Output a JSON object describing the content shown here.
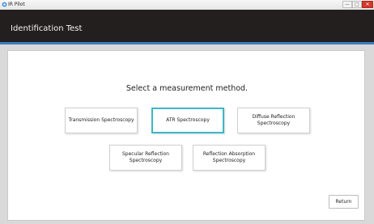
{
  "window": {
    "title": "IR Pilot",
    "controls": {
      "minimize": "—",
      "maximize": "□",
      "close": "✕"
    },
    "accent": "#3b7dbf"
  },
  "header": {
    "title": "Identification Test",
    "background": "#231f1f"
  },
  "main": {
    "prompt": "Select a measurement method.",
    "options": [
      {
        "label": "Transmission Spectroscopy",
        "selected": false
      },
      {
        "label": "ATR Spectroscopy",
        "selected": true
      },
      {
        "label": "Diffuse Reflection\nSpectroscopy",
        "selected": false
      },
      {
        "label": "Specular Reflection\nSpectroscopy",
        "selected": false
      },
      {
        "label": "Reflection Absorption\nSpectroscopy",
        "selected": false
      }
    ],
    "selected_color": "#3fb6c6"
  },
  "footer": {
    "return_label": "Return"
  }
}
